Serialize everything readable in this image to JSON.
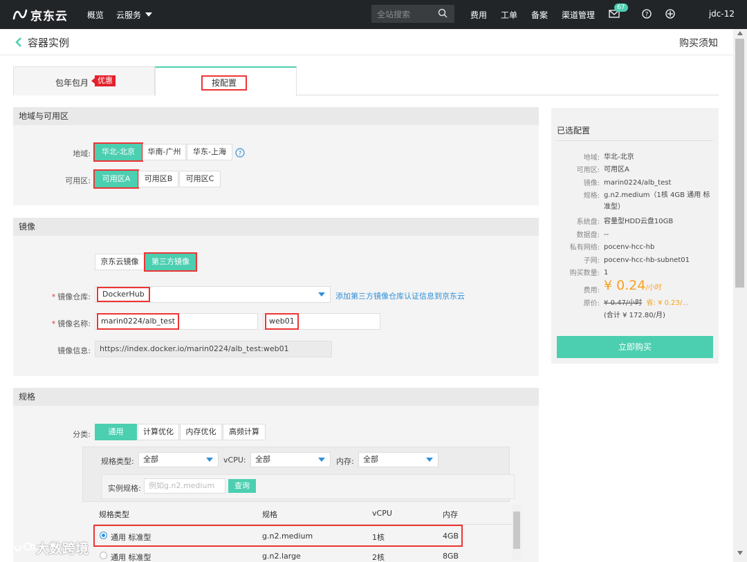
{
  "topbar": {
    "logo": "京东云",
    "nav": [
      "概览",
      "云服务"
    ],
    "search_placeholder": "全站搜索",
    "right": [
      "费用",
      "工单",
      "备案",
      "渠道管理"
    ],
    "message_count": "67",
    "user": "jdc-12"
  },
  "page": {
    "title": "容器实例",
    "purchase_notes": "购买须知"
  },
  "tabs": {
    "yearly": "包年包月",
    "promo": "优惠",
    "by_config": "按配置"
  },
  "region": {
    "header": "地域与可用区",
    "region_label": "地域:",
    "regions": [
      "华北-北京",
      "华南-广州",
      "华东-上海"
    ],
    "zone_label": "可用区:",
    "zones": [
      "可用区A",
      "可用区B",
      "可用区C"
    ]
  },
  "image": {
    "header": "镜像",
    "types": [
      "京东云镜像",
      "第三方镜像"
    ],
    "repo_label": "镜像仓库:",
    "repo_value": "DockerHub",
    "repo_link": "添加第三方镜像仓库认证信息到京东云",
    "name_label": "镜像名称:",
    "name_value": "marin0224/alb_test",
    "tag_value": "web01",
    "info_label": "镜像信息:",
    "info_value": "https://index.docker.io/marin0224/alb_test:web01"
  },
  "spec": {
    "header": "规格",
    "category_label": "分类:",
    "categories": [
      "通用",
      "计算优化",
      "内存优化",
      "高频计算"
    ],
    "filter_type_label": "规格类型:",
    "filter_type_value": "全部",
    "filter_vcpu_label": "vCPU:",
    "filter_vcpu_value": "全部",
    "filter_mem_label": "内存:",
    "filter_mem_value": "全部",
    "instance_label": "实例规格:",
    "instance_placeholder": "例如g.n2.medium",
    "query_button": "查询",
    "columns": [
      "规格类型",
      "规格",
      "vCPU",
      "内存"
    ],
    "rows": [
      {
        "type": "通用 标准型",
        "spec": "g.n2.medium",
        "vcpu": "1核",
        "mem": "4GB"
      },
      {
        "type": "通用 标准型",
        "spec": "g.n2.large",
        "vcpu": "2核",
        "mem": "8GB"
      }
    ]
  },
  "summary": {
    "title": "已选配置",
    "items": [
      {
        "k": "地域:",
        "v": "华北-北京"
      },
      {
        "k": "可用区:",
        "v": "可用区A"
      },
      {
        "k": "镜像:",
        "v": "marin0224/alb_test"
      },
      {
        "k": "规格:",
        "v": "g.n2.medium（1核 4GB 通用 标准型）"
      },
      {
        "k": "系统盘:",
        "v": "容量型HDD云盘10GB"
      },
      {
        "k": "数据盘:",
        "v": "--"
      },
      {
        "k": "私有网络:",
        "v": "pocenv-hcc-hb"
      },
      {
        "k": "子网:",
        "v": "pocenv-hcc-hb-subnet01"
      },
      {
        "k": "购买数量:",
        "v": "1"
      }
    ],
    "fee_label": "费用:",
    "price": "¥ 0.24",
    "price_unit": "/小时",
    "orig_label": "原价:",
    "orig_price": "¥ 0.47/小时",
    "save": "省: ¥ 0.23/...",
    "total": "(合计 ¥ 172.80/月)",
    "buy_button": "立即购买"
  },
  "watermark": "大数跨境"
}
